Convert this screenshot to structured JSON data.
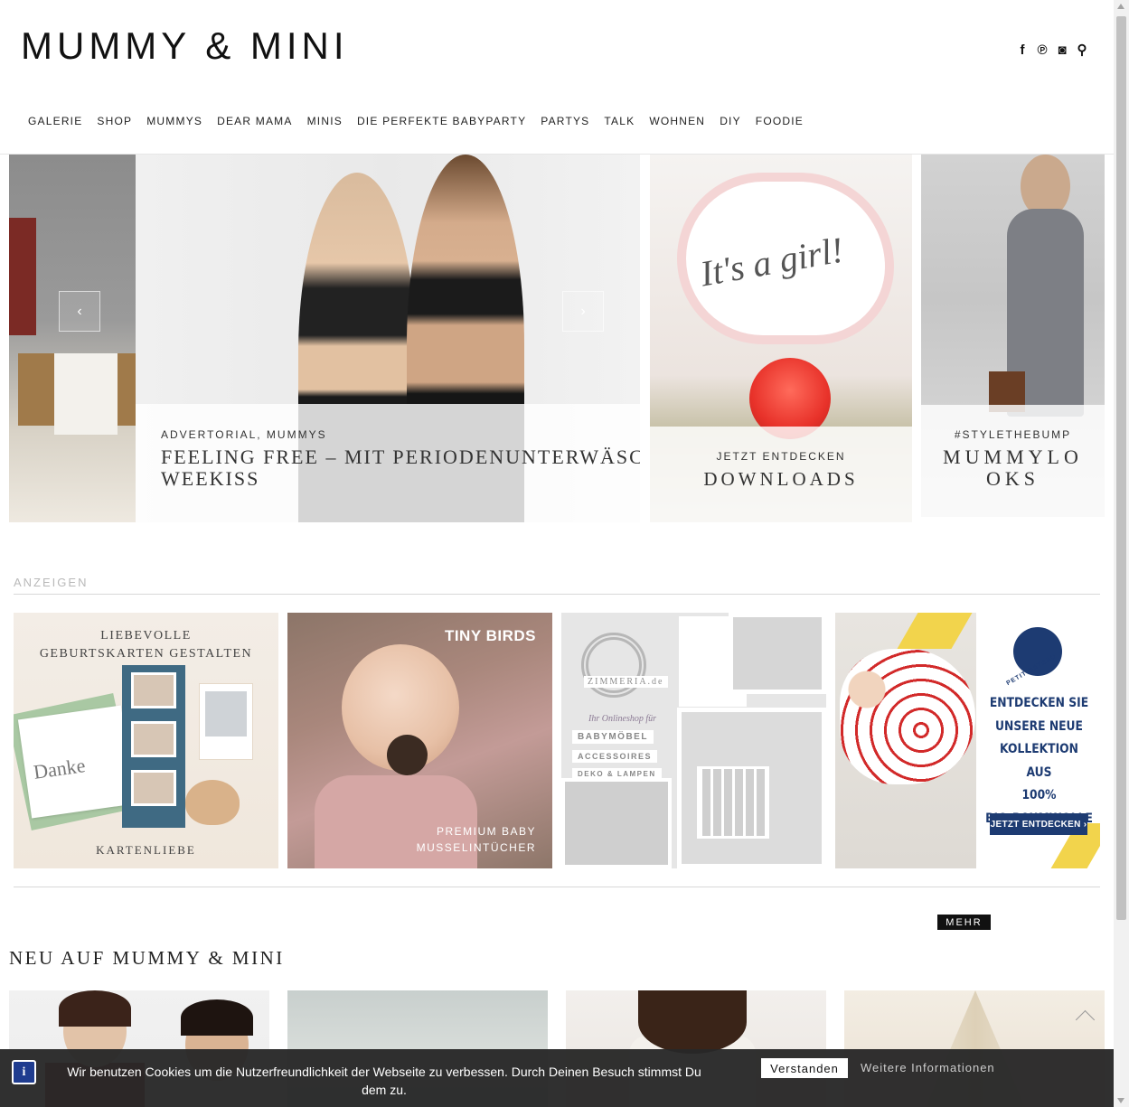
{
  "header": {
    "logo": "MUMMY & MINI",
    "social_icons": [
      "facebook-icon",
      "pinterest-icon",
      "instagram-icon",
      "search-icon"
    ],
    "social_glyphs": [
      "f",
      "℗",
      "◙",
      "⚲"
    ]
  },
  "nav": {
    "items": [
      "GALERIE",
      "SHOP",
      "MUMMYS",
      "DEAR MAMA",
      "MINIS",
      "DIE PERFEKTE BABYPARTY",
      "PARTYS",
      "TALK",
      "WOHNEN",
      "DIY",
      "FOODIE"
    ]
  },
  "slider": {
    "prev_arrow": "‹",
    "next_arrow": "›",
    "main": {
      "category": "ADVERTORIAL, MUMMYS",
      "title_line1": "FEELING FREE – MIT PERIODENUNTERWÄSCHE V",
      "title_line2": "WEEKISS"
    },
    "downloads": {
      "category": "JETZT ENTDECKEN",
      "title": "DOWNLOADS",
      "image_text": "It's a girl!"
    },
    "mummylooks": {
      "category": "#STYLETHEBUMP",
      "title": "MUMMYLOOKS"
    }
  },
  "ads": {
    "label": "ANZEIGEN",
    "kartenliebe": {
      "headline_line1": "LIEBEVOLLE",
      "headline_line2": "GEBURTSKARTEN GESTALTEN",
      "card_text": "Danke",
      "brand": "KARTENLIEBE"
    },
    "tinybirds": {
      "brand": "TINY BIRDS",
      "line1": "PREMIUM BABY",
      "line2": "MUSSELINTÜCHER"
    },
    "zimmeria": {
      "brand": "ZIMMERIA.de",
      "tagline": "Ihr Onlineshop für",
      "labels": [
        "BABYMÖBEL",
        "ACCESSOIRES",
        "DEKO & LAMPEN"
      ]
    },
    "petitbateau": {
      "brand": "PETIT BATEAU",
      "headline": [
        "ENTDECKEN SIE",
        "UNSERE NEUE",
        "KOLLEKTION AUS",
        "100%",
        "BIO-BAUMWOLLE"
      ],
      "button": "JETZT ENTDECKEN ›"
    }
  },
  "section": {
    "more_button": "MEHR",
    "title": "NEU AUF MUMMY & MINI"
  },
  "cookie": {
    "icon": "i",
    "text": "Wir benutzen Cookies um die Nutzerfreundlichkeit der Webseite zu verbessen. Durch Deinen Besuch stimmst Du dem zu.",
    "accept": "Verstanden",
    "more_info": "Weitere Informationen"
  }
}
